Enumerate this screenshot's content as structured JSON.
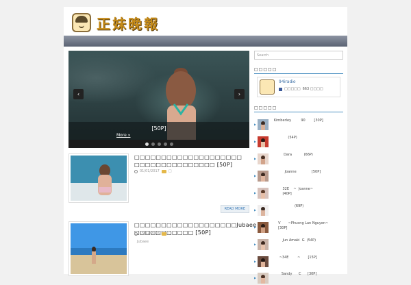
{
  "header": {
    "site_title": "正妹晚報"
  },
  "slider": {
    "title": "[50P]",
    "more": "More »",
    "prev": "‹",
    "next": "›"
  },
  "posts": [
    {
      "title": "□□□□□□□□□□□□□□□□□□□□ □□□□□□□□□□□□□□□ [50P]",
      "date": "01/01/2017",
      "category": "□",
      "read_more": "READ MORE"
    },
    {
      "title": "□□□□□□□□□□□□□□□□□□□Jubaee □□□□□□□□□□□ [50P]",
      "date": "15/12/2016",
      "category": "□",
      "author": "Jubaee"
    }
  ],
  "sidebar": {
    "search_placeholder": "Search",
    "widget1_title": "□□□□□",
    "radio": {
      "name": "94iradio",
      "fb_text": "□□□□□",
      "likes": "663 □□□□"
    },
    "widget2_title": "□□□□□",
    "items": [
      "   Kimberley         90        [30P]",
      "                (54P)",
      "            Dara           (66P)",
      "             Joanne              [50P]",
      "           32E    ~  Joanne~\n           [40P]",
      "                      (69P)",
      "       V       ~Phuong Lan Nguyen~\n       [30P]",
      "           Jun Amaki  G  (54P)",
      "        ~34E        ~       [15P]",
      "          Sandy      C      [30P]"
    ]
  }
}
